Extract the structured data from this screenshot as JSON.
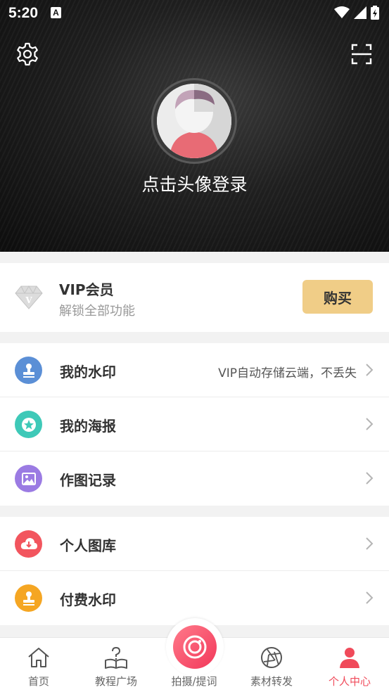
{
  "status_bar": {
    "time": "5:20",
    "notification_badge": "A"
  },
  "header": {
    "login_prompt": "点击头像登录"
  },
  "vip": {
    "title": "VIP会员",
    "subtitle": "解锁全部功能",
    "buy_label": "购买",
    "badge_letter": "V"
  },
  "menu_group_1": [
    {
      "label": "我的水印",
      "note": "VIP自动存储云端，不丢失",
      "icon": "stamp-icon",
      "color": "#5b8fd6"
    },
    {
      "label": "我的海报",
      "note": "",
      "icon": "star-icon",
      "color": "#3ec9b8"
    },
    {
      "label": "作图记录",
      "note": "",
      "icon": "image-icon",
      "color": "#9b7be3"
    }
  ],
  "menu_group_2": [
    {
      "label": "个人图库",
      "note": "",
      "icon": "cloud-download-icon",
      "color": "#f2555e"
    },
    {
      "label": "付费水印",
      "note": "",
      "icon": "stamp-icon",
      "color": "#f5a623"
    }
  ],
  "bottom_nav": [
    {
      "label": "首页",
      "icon": "home-icon"
    },
    {
      "label": "教程广场",
      "icon": "help-book-icon"
    },
    {
      "label": "拍摄/提词",
      "icon": "camera-icon"
    },
    {
      "label": "素材转发",
      "icon": "aperture-icon"
    },
    {
      "label": "个人中心",
      "icon": "person-icon",
      "active": true
    }
  ],
  "colors": {
    "accent": "#f04a5a",
    "vip_button": "#f0cd87"
  }
}
